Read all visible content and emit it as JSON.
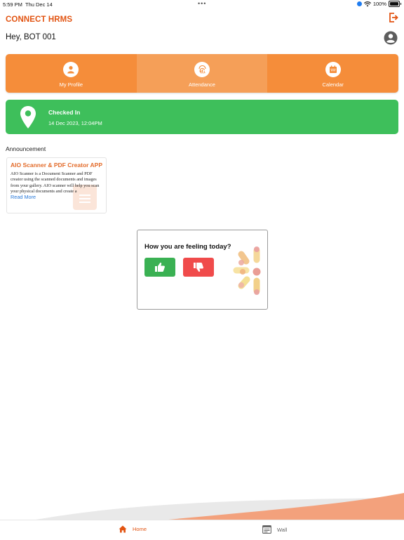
{
  "status_bar": {
    "time": "5:59 PM",
    "date": "Thu Dec 14",
    "battery": "100%"
  },
  "app": {
    "title": "CONNECT HRMS",
    "greeting": "Hey, BOT 001"
  },
  "quick_nav": [
    {
      "label": "My Profile",
      "icon": "user-icon"
    },
    {
      "label": "Attendance",
      "icon": "fingerprint-icon"
    },
    {
      "label": "Calendar",
      "icon": "calendar-icon"
    }
  ],
  "attendance": {
    "status": "Checked In",
    "timestamp": "14 Dec 2023, 12:04PM"
  },
  "announcement": {
    "section_label": "Announcement",
    "title": "AIO Scanner & PDF Creator APP",
    "body": "AIO Scanner is a Document Scanner and PDF creator using the scanned documents and images from your gallery. AIO scanner will help you scan your physical documents and create a",
    "read_more": "Read More"
  },
  "mood": {
    "question": "How you are feeling today?",
    "positive_icon": "thumbs-up-icon",
    "negative_icon": "thumbs-down-icon"
  },
  "tab_bar": [
    {
      "label": "Home",
      "icon": "home-icon",
      "active": true
    },
    {
      "label": "Wall",
      "icon": "wall-icon",
      "active": false
    }
  ],
  "colors": {
    "brand": "#e25412",
    "orange": "#f58d3a",
    "green": "#3ebf5b",
    "red": "#f04b4b",
    "link": "#2a7ad9"
  }
}
